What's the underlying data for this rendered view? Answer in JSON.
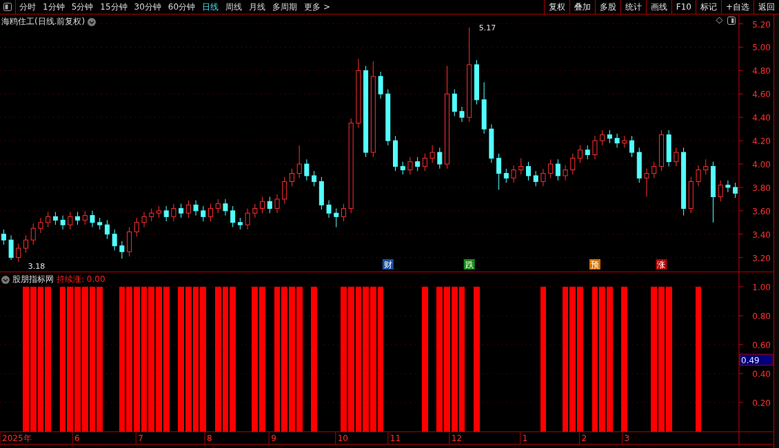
{
  "toolbar": {
    "periods": [
      {
        "label": "分时",
        "selected": false
      },
      {
        "label": "1分钟",
        "selected": false
      },
      {
        "label": "5分钟",
        "selected": false
      },
      {
        "label": "15分钟",
        "selected": false
      },
      {
        "label": "30分钟",
        "selected": false
      },
      {
        "label": "60分钟",
        "selected": false
      },
      {
        "label": "日线",
        "selected": true
      },
      {
        "label": "周线",
        "selected": false
      },
      {
        "label": "月线",
        "selected": false
      },
      {
        "label": "多周期",
        "selected": false
      },
      {
        "label": "更多 >",
        "selected": false
      }
    ],
    "buttons": [
      "复权",
      "叠加",
      "多股",
      "统计",
      "画线",
      "F10",
      "标记",
      "+自选",
      "返回"
    ]
  },
  "price_panel": {
    "title": "海鸥住工(日线.前复权)",
    "high_label": "5.17",
    "low_label": "3.18",
    "events": [
      {
        "label": "财",
        "color": "#1c4f9c"
      },
      {
        "label": "跌",
        "color": "#1a8a1a"
      },
      {
        "label": "预",
        "color": "#d07000"
      },
      {
        "label": "涨",
        "color": "#b00000"
      }
    ],
    "chart_data": {
      "type": "candlestick",
      "ylim": [
        3.08,
        5.28
      ],
      "grid": true,
      "yticks": [
        {
          "value": 3.2,
          "label": "3.20"
        },
        {
          "value": 3.4,
          "label": "3.40"
        },
        {
          "value": 3.6,
          "label": "3.60"
        },
        {
          "value": 3.8,
          "label": "3.80"
        },
        {
          "value": 4.0,
          "label": "4.00"
        },
        {
          "value": 4.2,
          "label": "4.20"
        },
        {
          "value": 4.4,
          "label": "4.40"
        },
        {
          "value": 4.6,
          "label": "4.60"
        },
        {
          "value": 4.8,
          "label": "4.80"
        },
        {
          "value": 5.0,
          "label": "5.00"
        },
        {
          "value": 5.2,
          "label": "5.20"
        }
      ],
      "ohlc": [
        [
          3.4,
          3.44,
          3.31,
          3.35
        ],
        [
          3.35,
          3.39,
          3.18,
          3.2
        ],
        [
          3.2,
          3.32,
          3.16,
          3.28
        ],
        [
          3.28,
          3.39,
          3.24,
          3.35
        ],
        [
          3.35,
          3.49,
          3.31,
          3.45
        ],
        [
          3.45,
          3.54,
          3.41,
          3.5
        ],
        [
          3.5,
          3.59,
          3.46,
          3.55
        ],
        [
          3.55,
          3.59,
          3.48,
          3.52
        ],
        [
          3.52,
          3.56,
          3.44,
          3.48
        ],
        [
          3.48,
          3.59,
          3.44,
          3.55
        ],
        [
          3.55,
          3.59,
          3.48,
          3.52
        ],
        [
          3.52,
          3.6,
          3.48,
          3.56
        ],
        [
          3.56,
          3.6,
          3.46,
          3.5
        ],
        [
          3.5,
          3.54,
          3.44,
          3.48
        ],
        [
          3.48,
          3.52,
          3.36,
          3.4
        ],
        [
          3.4,
          3.44,
          3.26,
          3.3
        ],
        [
          3.3,
          3.34,
          3.19,
          3.25
        ],
        [
          3.25,
          3.46,
          3.21,
          3.42
        ],
        [
          3.42,
          3.54,
          3.38,
          3.5
        ],
        [
          3.5,
          3.59,
          3.46,
          3.55
        ],
        [
          3.55,
          3.62,
          3.51,
          3.58
        ],
        [
          3.58,
          3.64,
          3.54,
          3.6
        ],
        [
          3.6,
          3.64,
          3.51,
          3.55
        ],
        [
          3.55,
          3.66,
          3.51,
          3.62
        ],
        [
          3.62,
          3.66,
          3.54,
          3.58
        ],
        [
          3.58,
          3.69,
          3.54,
          3.65
        ],
        [
          3.65,
          3.69,
          3.56,
          3.6
        ],
        [
          3.6,
          3.64,
          3.51,
          3.55
        ],
        [
          3.55,
          3.66,
          3.51,
          3.62
        ],
        [
          3.62,
          3.7,
          3.58,
          3.66
        ],
        [
          3.66,
          3.7,
          3.56,
          3.6
        ],
        [
          3.6,
          3.64,
          3.46,
          3.5
        ],
        [
          3.5,
          3.54,
          3.44,
          3.48
        ],
        [
          3.48,
          3.62,
          3.44,
          3.58
        ],
        [
          3.58,
          3.66,
          3.54,
          3.62
        ],
        [
          3.62,
          3.72,
          3.58,
          3.68
        ],
        [
          3.68,
          3.72,
          3.58,
          3.62
        ],
        [
          3.62,
          3.74,
          3.58,
          3.7
        ],
        [
          3.7,
          3.89,
          3.66,
          3.85
        ],
        [
          3.85,
          3.96,
          3.81,
          3.92
        ],
        [
          3.92,
          4.16,
          3.88,
          4.0
        ],
        [
          4.0,
          4.04,
          3.86,
          3.9
        ],
        [
          3.9,
          3.94,
          3.81,
          3.85
        ],
        [
          3.85,
          3.89,
          3.61,
          3.65
        ],
        [
          3.65,
          3.69,
          3.54,
          3.58
        ],
        [
          3.58,
          3.62,
          3.46,
          3.55
        ],
        [
          3.55,
          3.66,
          3.51,
          3.62
        ],
        [
          3.62,
          4.39,
          3.58,
          4.35
        ],
        [
          4.35,
          4.9,
          4.31,
          4.8
        ],
        [
          4.8,
          4.84,
          4.06,
          4.1
        ],
        [
          4.1,
          4.88,
          4.06,
          4.75
        ],
        [
          4.75,
          4.79,
          4.56,
          4.6
        ],
        [
          4.6,
          4.64,
          4.16,
          4.2
        ],
        [
          4.2,
          4.24,
          3.94,
          3.98
        ],
        [
          3.98,
          4.02,
          3.91,
          3.95
        ],
        [
          3.95,
          4.06,
          3.91,
          4.02
        ],
        [
          4.02,
          4.06,
          3.94,
          3.98
        ],
        [
          3.98,
          4.09,
          3.94,
          4.05
        ],
        [
          4.05,
          4.16,
          4.01,
          4.1
        ],
        [
          4.1,
          4.14,
          3.96,
          4.0
        ],
        [
          4.0,
          4.84,
          3.96,
          4.6
        ],
        [
          4.6,
          4.64,
          4.41,
          4.45
        ],
        [
          4.45,
          4.49,
          4.36,
          4.4
        ],
        [
          4.4,
          5.17,
          4.36,
          4.85
        ],
        [
          4.85,
          4.89,
          4.51,
          4.55
        ],
        [
          4.55,
          4.7,
          4.26,
          4.3
        ],
        [
          4.3,
          4.34,
          4.01,
          4.05
        ],
        [
          4.05,
          4.09,
          3.78,
          3.92
        ],
        [
          3.92,
          3.96,
          3.84,
          3.88
        ],
        [
          3.88,
          3.99,
          3.84,
          3.95
        ],
        [
          3.95,
          4.05,
          3.91,
          3.98
        ],
        [
          3.98,
          4.02,
          3.86,
          3.9
        ],
        [
          3.9,
          3.94,
          3.81,
          3.85
        ],
        [
          3.85,
          3.96,
          3.81,
          3.92
        ],
        [
          3.92,
          4.04,
          3.88,
          4.0
        ],
        [
          4.0,
          4.04,
          3.86,
          3.9
        ],
        [
          3.9,
          3.99,
          3.86,
          3.95
        ],
        [
          3.95,
          4.09,
          3.91,
          4.05
        ],
        [
          4.05,
          4.16,
          4.01,
          4.12
        ],
        [
          4.12,
          4.16,
          4.04,
          4.08
        ],
        [
          4.08,
          4.24,
          4.04,
          4.2
        ],
        [
          4.2,
          4.29,
          4.16,
          4.25
        ],
        [
          4.25,
          4.29,
          4.18,
          4.22
        ],
        [
          4.22,
          4.26,
          4.14,
          4.18
        ],
        [
          4.18,
          4.24,
          4.14,
          4.2
        ],
        [
          4.2,
          4.24,
          4.06,
          4.1
        ],
        [
          4.1,
          4.14,
          3.84,
          3.88
        ],
        [
          3.88,
          3.96,
          3.72,
          3.92
        ],
        [
          3.92,
          4.02,
          3.88,
          3.98
        ],
        [
          3.98,
          4.29,
          3.94,
          4.25
        ],
        [
          4.25,
          4.29,
          3.98,
          4.02
        ],
        [
          4.02,
          4.14,
          3.98,
          4.1
        ],
        [
          4.1,
          4.14,
          3.56,
          3.62
        ],
        [
          3.62,
          3.89,
          3.58,
          3.85
        ],
        [
          3.85,
          3.99,
          3.81,
          3.95
        ],
        [
          3.95,
          4.04,
          3.91,
          3.98
        ],
        [
          3.98,
          4.02,
          3.5,
          3.72
        ],
        [
          3.72,
          3.86,
          3.68,
          3.82
        ],
        [
          3.82,
          3.86,
          3.76,
          3.8
        ],
        [
          3.8,
          3.84,
          3.71,
          3.75
        ]
      ]
    }
  },
  "indicator_panel": {
    "title": "股朋指标网",
    "reading": "持续涨: 0.00",
    "value_box": "0.49",
    "chart_data": {
      "type": "bar",
      "ylim": [
        0,
        1.1
      ],
      "grid": true,
      "yticks": [
        {
          "value": 0.2,
          "label": "0.20"
        },
        {
          "value": 0.4,
          "label": "0.40"
        },
        {
          "value": 0.6,
          "label": "0.60"
        },
        {
          "value": 0.8,
          "label": "0.80"
        },
        {
          "value": 1.0,
          "label": "1.00"
        }
      ],
      "values": [
        0,
        0,
        0,
        1,
        1,
        1,
        1,
        0,
        1,
        1,
        1,
        1,
        1,
        1,
        0,
        0,
        1,
        1,
        1,
        1,
        1,
        1,
        1,
        0,
        1,
        1,
        1,
        1,
        0,
        1,
        1,
        1,
        0,
        0,
        1,
        1,
        0,
        1,
        1,
        1,
        1,
        0,
        1,
        0,
        0,
        0,
        1,
        1,
        1,
        1,
        1,
        1,
        0,
        0,
        0,
        0,
        0,
        1,
        0,
        1,
        1,
        1,
        1,
        0,
        1,
        0,
        0,
        0,
        0,
        0,
        0,
        0,
        0,
        1,
        0,
        0,
        1,
        1,
        1,
        0,
        1,
        1,
        1,
        0,
        1,
        0,
        0,
        0,
        1,
        1,
        1,
        0,
        0,
        0,
        1,
        0,
        0,
        0,
        0,
        0
      ]
    }
  },
  "date_axis": [
    "2025年",
    "6",
    "7",
    "8",
    "9",
    "10",
    "11",
    "12",
    "1",
    "2",
    "3"
  ]
}
